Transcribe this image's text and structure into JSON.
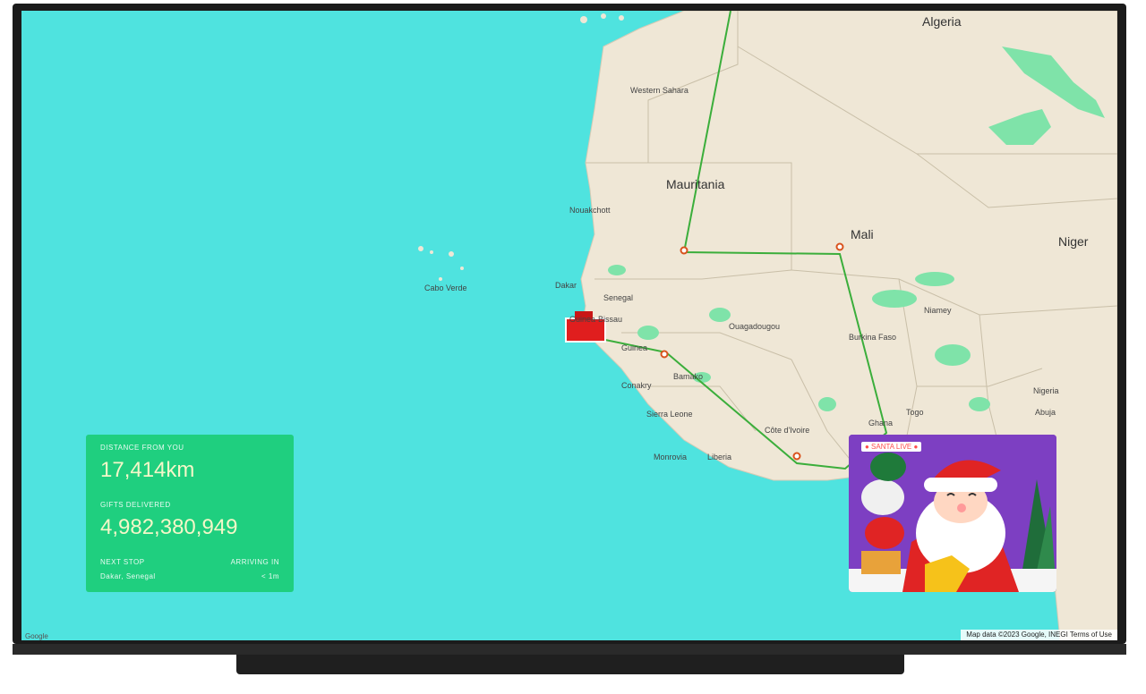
{
  "map": {
    "countries": {
      "algeria": "Algeria",
      "mauritania": "Mauritania",
      "mali": "Mali",
      "niger": "Niger"
    },
    "cities": {
      "western_sahara": "Western Sahara",
      "cabo_verde": "Cabo Verde",
      "dakar": "Dakar",
      "senegal": "Senegal",
      "guinea_bissau": "Guinea-Bissau",
      "guinea": "Guinea",
      "conakry": "Conakry",
      "sierra_leone": "Sierra Leone",
      "bamako": "Bamako",
      "burkina_faso": "Burkina Faso",
      "cote_divoire": "Côte d'Ivoire",
      "monrovia": "Monrovia",
      "liberia": "Liberia",
      "ghana": "Ghana",
      "togo": "Togo",
      "nigeria": "Nigeria",
      "abuja": "Abuja",
      "niamey": "Niamey",
      "ouagadougou": "Ouagadougou",
      "nouakchott": "Nouakchott"
    },
    "attribution": "Map data ©2023 Google, INEGI  Terms of Use",
    "attribution_left": "Google"
  },
  "panel": {
    "distance_label": "DISTANCE FROM YOU",
    "distance_value": "17,414km",
    "gifts_label": "GIFTS DELIVERED",
    "gifts_value": "4,982,380,949",
    "next_stop_label": "NEXT STOP",
    "next_stop_value": "Dakar, Senegal",
    "arriving_label": "ARRIVING IN",
    "arriving_value": "< 1m"
  },
  "santa_card": {
    "badge": "● SANTA LIVE ●"
  },
  "colors": {
    "ocean": "#4fe3df",
    "land": "#efe7d6",
    "park": "#7fe3a9",
    "route": "#3bae3b",
    "panel": "#1fcf7f",
    "card": "#7d3fc2"
  }
}
